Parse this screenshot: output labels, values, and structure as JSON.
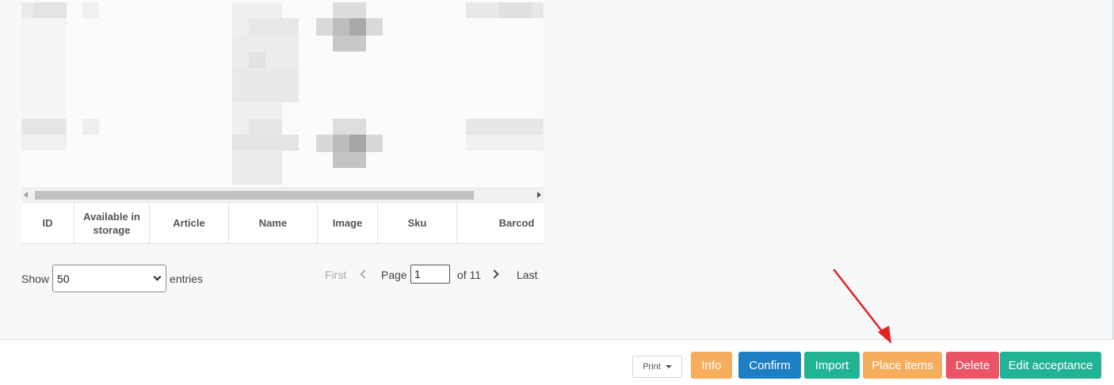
{
  "table": {
    "columns": [
      "ID",
      "Available in storage",
      "Article",
      "Name",
      "Image",
      "Sku",
      "Barcod"
    ]
  },
  "length_control": {
    "show_label": "Show",
    "selected_value": "50",
    "entries_label": "entries"
  },
  "pagination": {
    "first": "First",
    "page_label": "Page",
    "page_value": "1",
    "of_label": "of 11",
    "last": "Last"
  },
  "footer": {
    "print_label": "Print",
    "buttons": {
      "info": "Info",
      "confirm": "Confirm",
      "import": "Import",
      "place_items": "Place items",
      "delete": "Delete",
      "edit_acceptance": "Edit acceptance"
    }
  },
  "colors": {
    "info": "#f7ad5e",
    "confirm": "#1e7ec4",
    "import": "#21b394",
    "place_items": "#f7ad5e",
    "delete": "#ea5466",
    "edit_acceptance": "#21b394",
    "annotation_arrow": "#e32222"
  }
}
